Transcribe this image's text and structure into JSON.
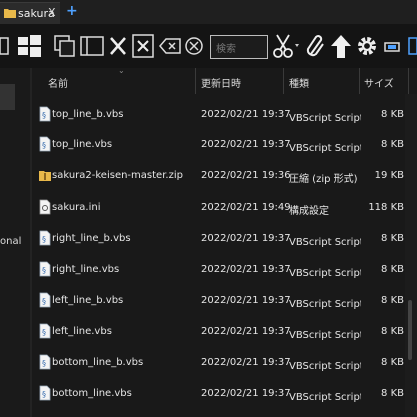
{
  "tabs": [
    {
      "label": "sakura",
      "close": "X"
    }
  ],
  "tab_add": "+",
  "toolbar": {
    "filter_placeholder": "検索",
    "icons": [
      "partial-grid-icon",
      "windows-logo-icon",
      "duplicate-window-icon",
      "window-icon",
      "close-x-icon",
      "close-box-icon",
      "backspace-icon",
      "circle-x-icon",
      "search-box",
      "scissors-icon",
      "paperclip-icon",
      "up-arrow-icon",
      "gear-icon",
      "minimize-icon"
    ]
  },
  "left_pane": {
    "fragment": "onal"
  },
  "columns": {
    "name": "名前",
    "date": "更新日時",
    "type": "種類",
    "size": "サイズ"
  },
  "files": [
    {
      "name": "top_line_b.vbs",
      "date": "2022/02/21 19:37",
      "type": "VBScript Script ファイル",
      "size": "8 KB",
      "icon": "vbs-script-icon"
    },
    {
      "name": "top_line.vbs",
      "date": "2022/02/21 19:37",
      "type": "VBScript Script ファイル",
      "size": "8 KB",
      "icon": "vbs-script-icon"
    },
    {
      "name": "sakura2-keisen-master.zip",
      "date": "2022/02/21 19:36",
      "type": "圧縮 (zip 形式) フォルダー",
      "size": "19 KB",
      "icon": "zip-folder-icon"
    },
    {
      "name": "sakura.ini",
      "date": "2022/02/21 19:49",
      "type": "構成設定",
      "size": "118 KB",
      "icon": "ini-file-icon"
    },
    {
      "name": "right_line_b.vbs",
      "date": "2022/02/21 19:37",
      "type": "VBScript Script ファイル",
      "size": "8 KB",
      "icon": "vbs-script-icon"
    },
    {
      "name": "right_line.vbs",
      "date": "2022/02/21 19:37",
      "type": "VBScript Script ファイル",
      "size": "8 KB",
      "icon": "vbs-script-icon"
    },
    {
      "name": "left_line_b.vbs",
      "date": "2022/02/21 19:37",
      "type": "VBScript Script ファイル",
      "size": "8 KB",
      "icon": "vbs-script-icon"
    },
    {
      "name": "left_line.vbs",
      "date": "2022/02/21 19:37",
      "type": "VBScript Script ファイル",
      "size": "8 KB",
      "icon": "vbs-script-icon"
    },
    {
      "name": "bottom_line_b.vbs",
      "date": "2022/02/21 19:37",
      "type": "VBScript Script ファイル",
      "size": "8 KB",
      "icon": "vbs-script-icon"
    },
    {
      "name": "bottom_line.vbs",
      "date": "2022/02/21 19:37",
      "type": "VBScript Script ファイル",
      "size": "8 KB",
      "icon": "vbs-script-icon"
    }
  ],
  "colors": {
    "background": "#191919",
    "text": "#e6e6e6",
    "folder": "#e8b84a",
    "accent": "#4ea1ff"
  }
}
